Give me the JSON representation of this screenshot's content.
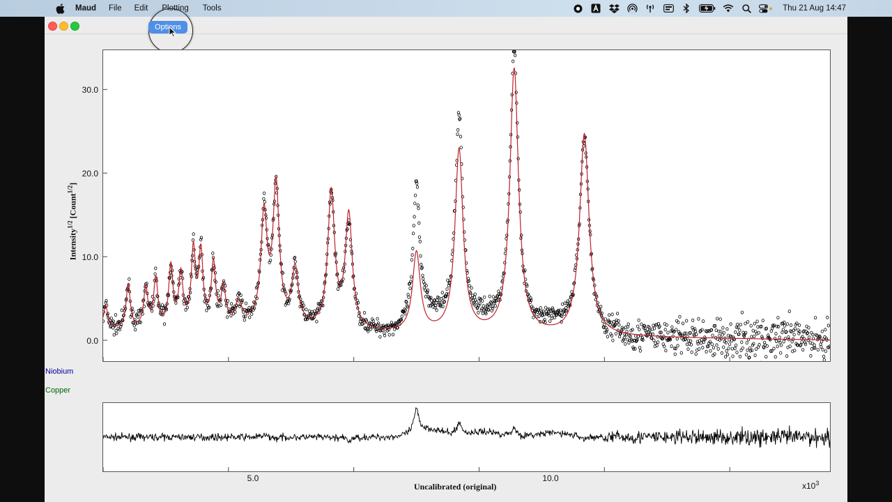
{
  "menubar": {
    "app_name": "Maud",
    "menus": [
      "File",
      "Edit",
      "Plotting",
      "Tools"
    ],
    "clock": "Thu 21 Aug  14:47",
    "status_icons": [
      "record-icon",
      "text-input-icon",
      "dropbox-icon",
      "airdrop-icon",
      "antenna-icon",
      "display-icon",
      "bluetooth-icon",
      "battery-icon",
      "wifi-icon",
      "spotlight-icon",
      "control-center-icon"
    ]
  },
  "window": {
    "options_button": "Options"
  },
  "legend": {
    "phases": [
      {
        "name": "Niobium",
        "color": "#0000a0"
      },
      {
        "name": "Copper",
        "color": "#006400"
      }
    ]
  },
  "plot": {
    "ylabel_main": "Intensity",
    "ylabel_sup1": "1/2",
    "ylabel_mid": " [Count",
    "ylabel_sup2": "1/2",
    "ylabel_end": "]",
    "y_ticks": [
      "30.0",
      "20.0",
      "10.0",
      "0.0"
    ],
    "x_ticks": [
      "5.0",
      "10.0"
    ],
    "xlabel": "Uncalibrated (original)",
    "x_multiplier": "x10",
    "x_multiplier_exp": "3"
  },
  "chart_data": {
    "type": "scatter",
    "xlabel": "Uncalibrated (original)",
    "ylabel": "Intensity^1/2 [Count^1/2]",
    "xlim": [
      2.5,
      17.0
    ],
    "ylim": [
      -2.5,
      34.7
    ],
    "x_scale_note": "x10^3",
    "series": [
      {
        "style": "points",
        "color": "#000000"
      },
      {
        "style": "line",
        "color": "#c0202a"
      }
    ],
    "peaks_fit": [
      {
        "x": 2.55,
        "y": 4.0
      },
      {
        "x": 3.0,
        "y": 6.5
      },
      {
        "x": 3.35,
        "y": 6.0
      },
      {
        "x": 3.55,
        "y": 7.0
      },
      {
        "x": 3.85,
        "y": 8.5
      },
      {
        "x": 4.05,
        "y": 7.5
      },
      {
        "x": 4.3,
        "y": 10.3
      },
      {
        "x": 4.45,
        "y": 10.0
      },
      {
        "x": 4.7,
        "y": 8.8
      },
      {
        "x": 4.9,
        "y": 6.0
      },
      {
        "x": 5.2,
        "y": 4.3
      },
      {
        "x": 5.71,
        "y": 14.5
      },
      {
        "x": 5.95,
        "y": 17.9
      },
      {
        "x": 6.33,
        "y": 8.0
      },
      {
        "x": 7.05,
        "y": 17.2
      },
      {
        "x": 7.4,
        "y": 14.5
      },
      {
        "x": 8.75,
        "y": 10.2
      },
      {
        "x": 9.6,
        "y": 22.5
      },
      {
        "x": 10.7,
        "y": 32.2
      },
      {
        "x": 12.1,
        "y": 24.5
      }
    ],
    "peaks_observed": [
      {
        "x": 5.71,
        "y": 15.0
      },
      {
        "x": 5.95,
        "y": 17.5
      },
      {
        "x": 7.05,
        "y": 17.0
      },
      {
        "x": 7.4,
        "y": 13.3
      },
      {
        "x": 8.75,
        "y": 16.7
      },
      {
        "x": 9.6,
        "y": 26.0
      },
      {
        "x": 10.7,
        "y": 34.5
      },
      {
        "x": 12.1,
        "y": 23.8
      }
    ],
    "background_fit": {
      "start": 1.2,
      "end": 0.0
    }
  }
}
